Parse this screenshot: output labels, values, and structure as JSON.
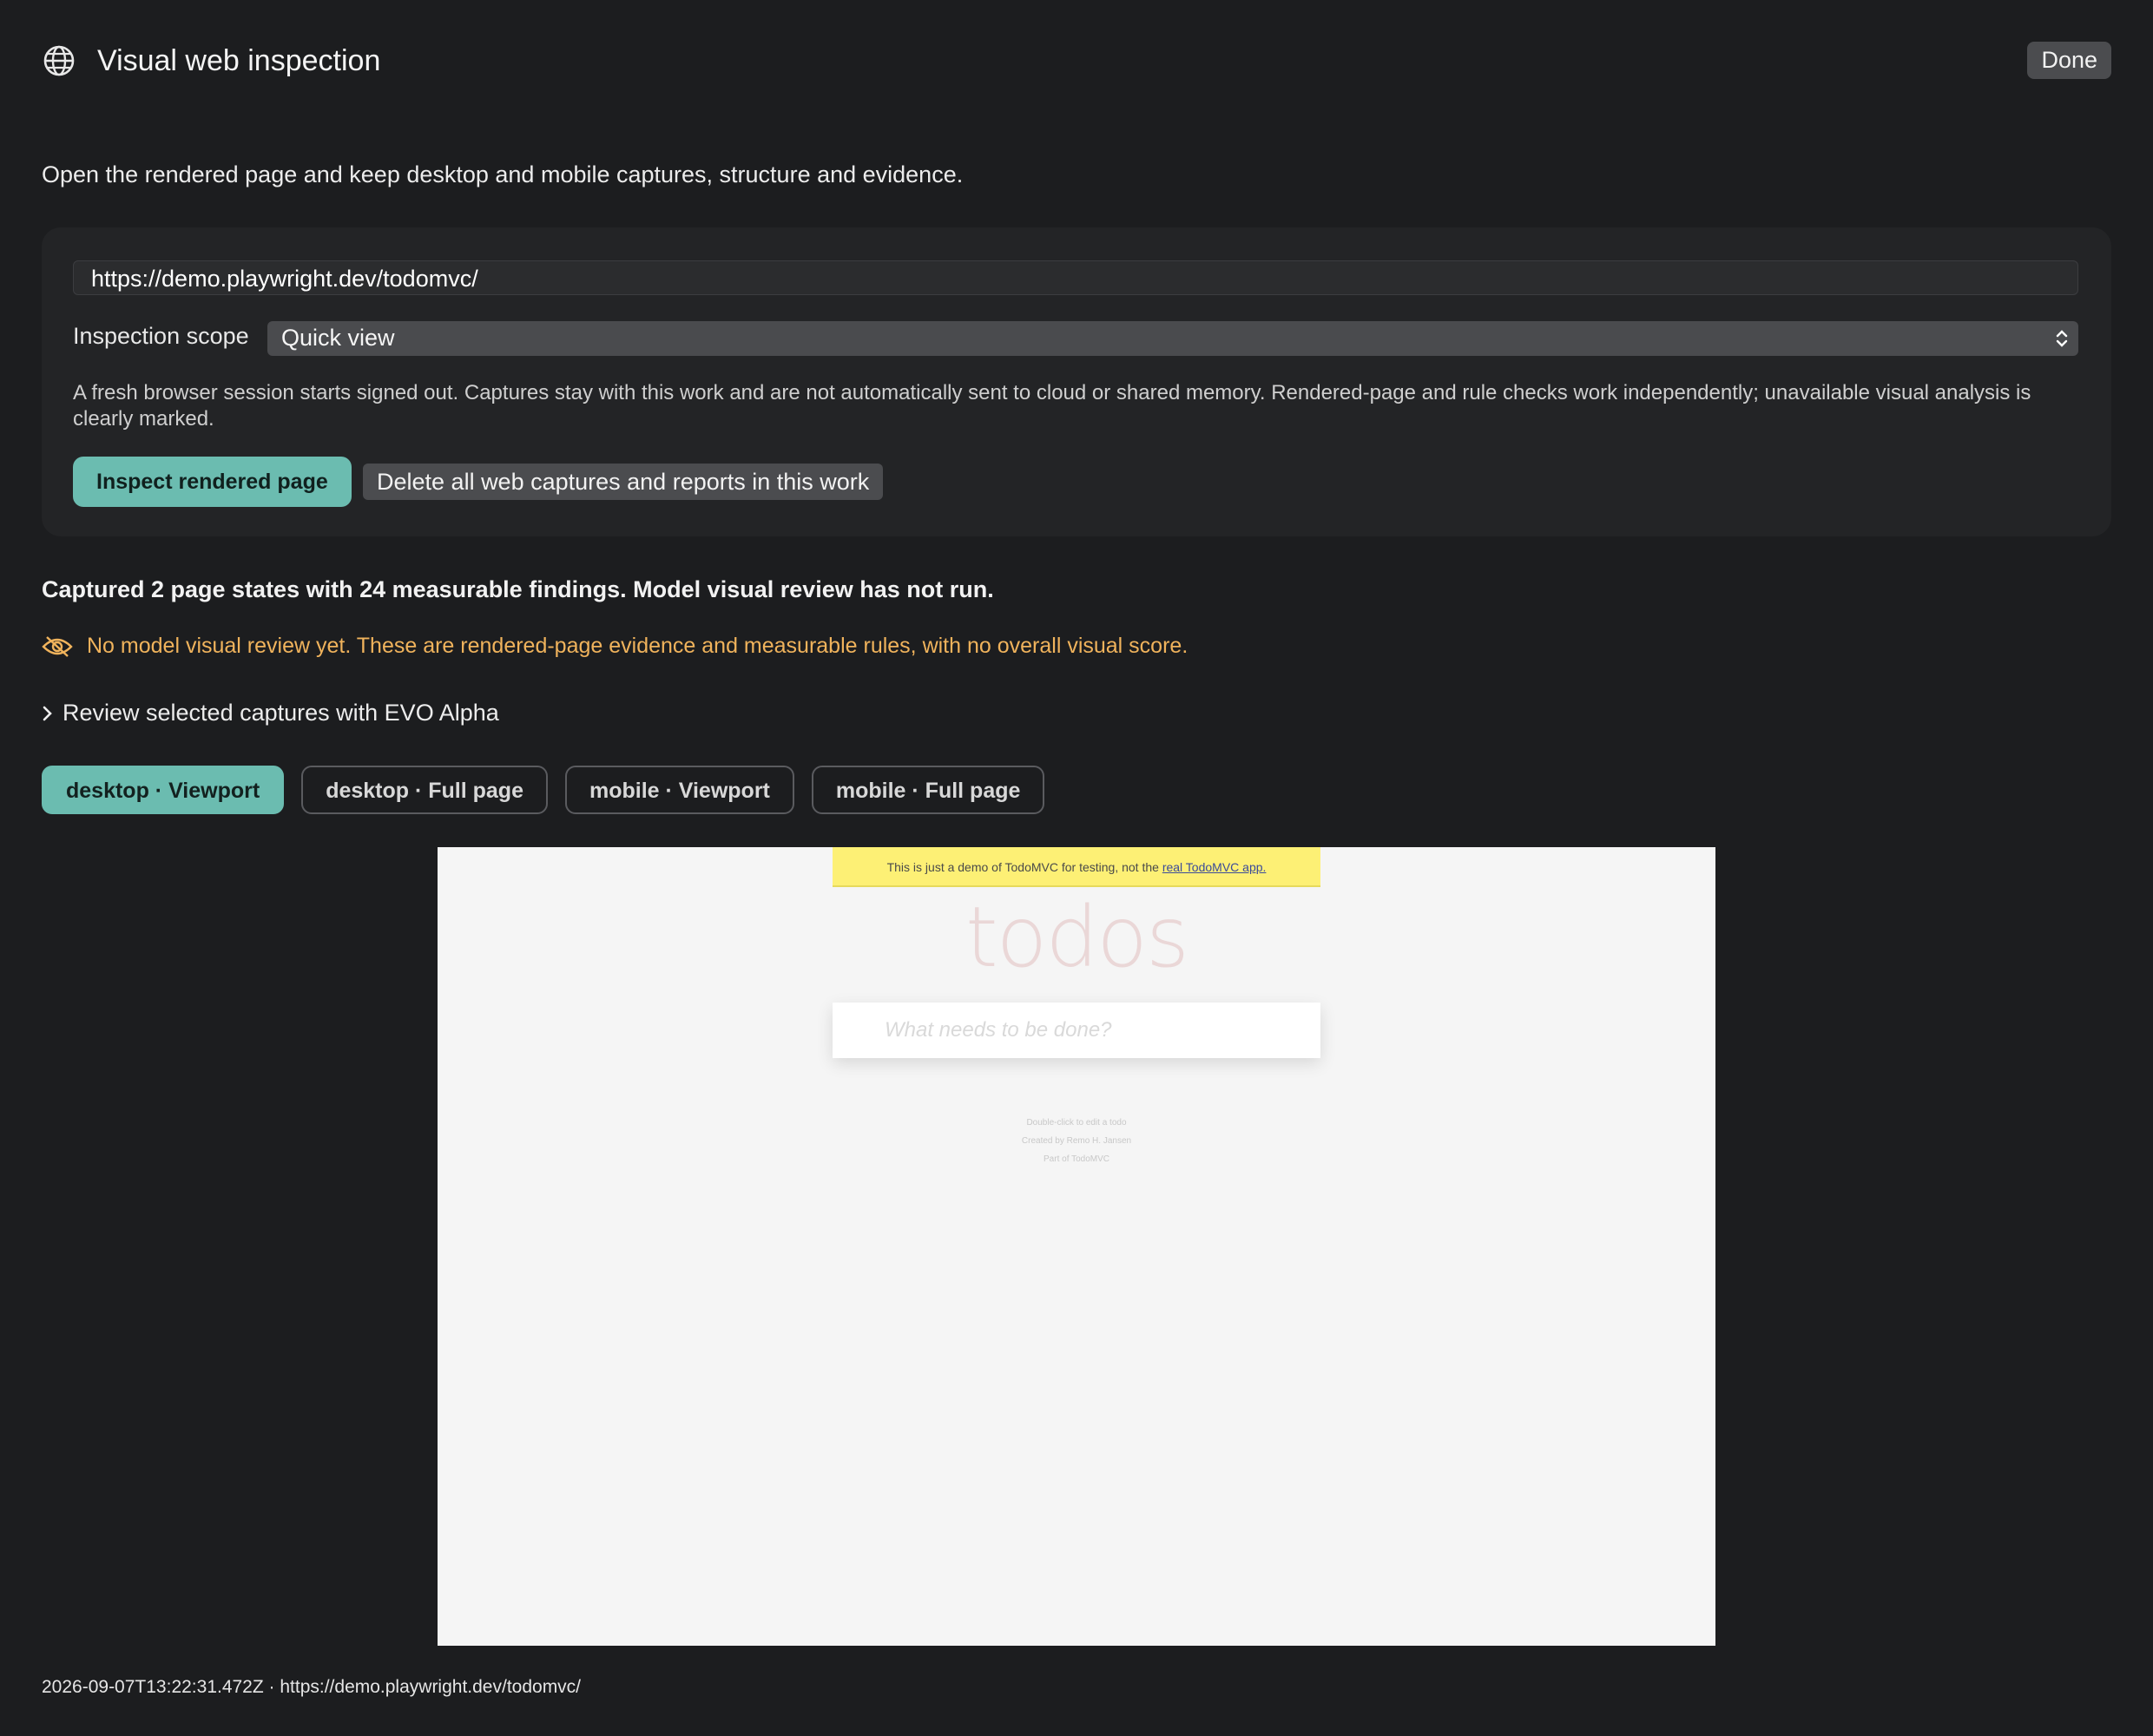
{
  "header": {
    "title": "Visual web inspection",
    "done_label": "Done",
    "icon": "globe-icon"
  },
  "intro": "Open the rendered page and keep desktop and mobile captures, structure and evidence.",
  "form": {
    "url_value": "https://demo.playwright.dev/todomvc/",
    "scope_label": "Inspection scope",
    "scope_value": "Quick view",
    "note": "A fresh browser session starts signed out. Captures stay with this work and are not automatically sent to cloud or shared memory. Rendered-page and rule checks work independently; unavailable visual analysis is clearly marked.",
    "inspect_label": "Inspect rendered page",
    "delete_label": "Delete all web captures and reports in this work"
  },
  "summary": "Captured 2 page states with 24 measurable findings. Model visual review has not run.",
  "warning": {
    "icon": "eye-slash-icon",
    "text": "No model visual review yet. These are rendered-page evidence and measurable rules, with no overall visual score.",
    "color": "#f0b35c"
  },
  "disclosure": {
    "label": "Review selected captures with EVO Alpha",
    "icon": "chevron-right-icon"
  },
  "tabs": [
    {
      "label": "desktop · Viewport",
      "active": true
    },
    {
      "label": "desktop · Full page",
      "active": false
    },
    {
      "label": "mobile · Viewport",
      "active": false
    },
    {
      "label": "mobile · Full page",
      "active": false
    }
  ],
  "preview": {
    "banner_text": "This is just a demo of TodoMVC for testing, not the ",
    "banner_link": "real TodoMVC app.",
    "heading": "todos",
    "input_placeholder": "What needs to be done?",
    "footer": [
      "Double-click to edit a todo",
      "Created by Remo H. Jansen",
      "Part of TodoMVC"
    ]
  },
  "meta": "2026-09-07T13:22:31.472Z · https://demo.playwright.dev/todomvc/",
  "colors": {
    "accent": "#6bbcb0",
    "background": "#1c1d1f",
    "warning": "#f0b35c"
  }
}
